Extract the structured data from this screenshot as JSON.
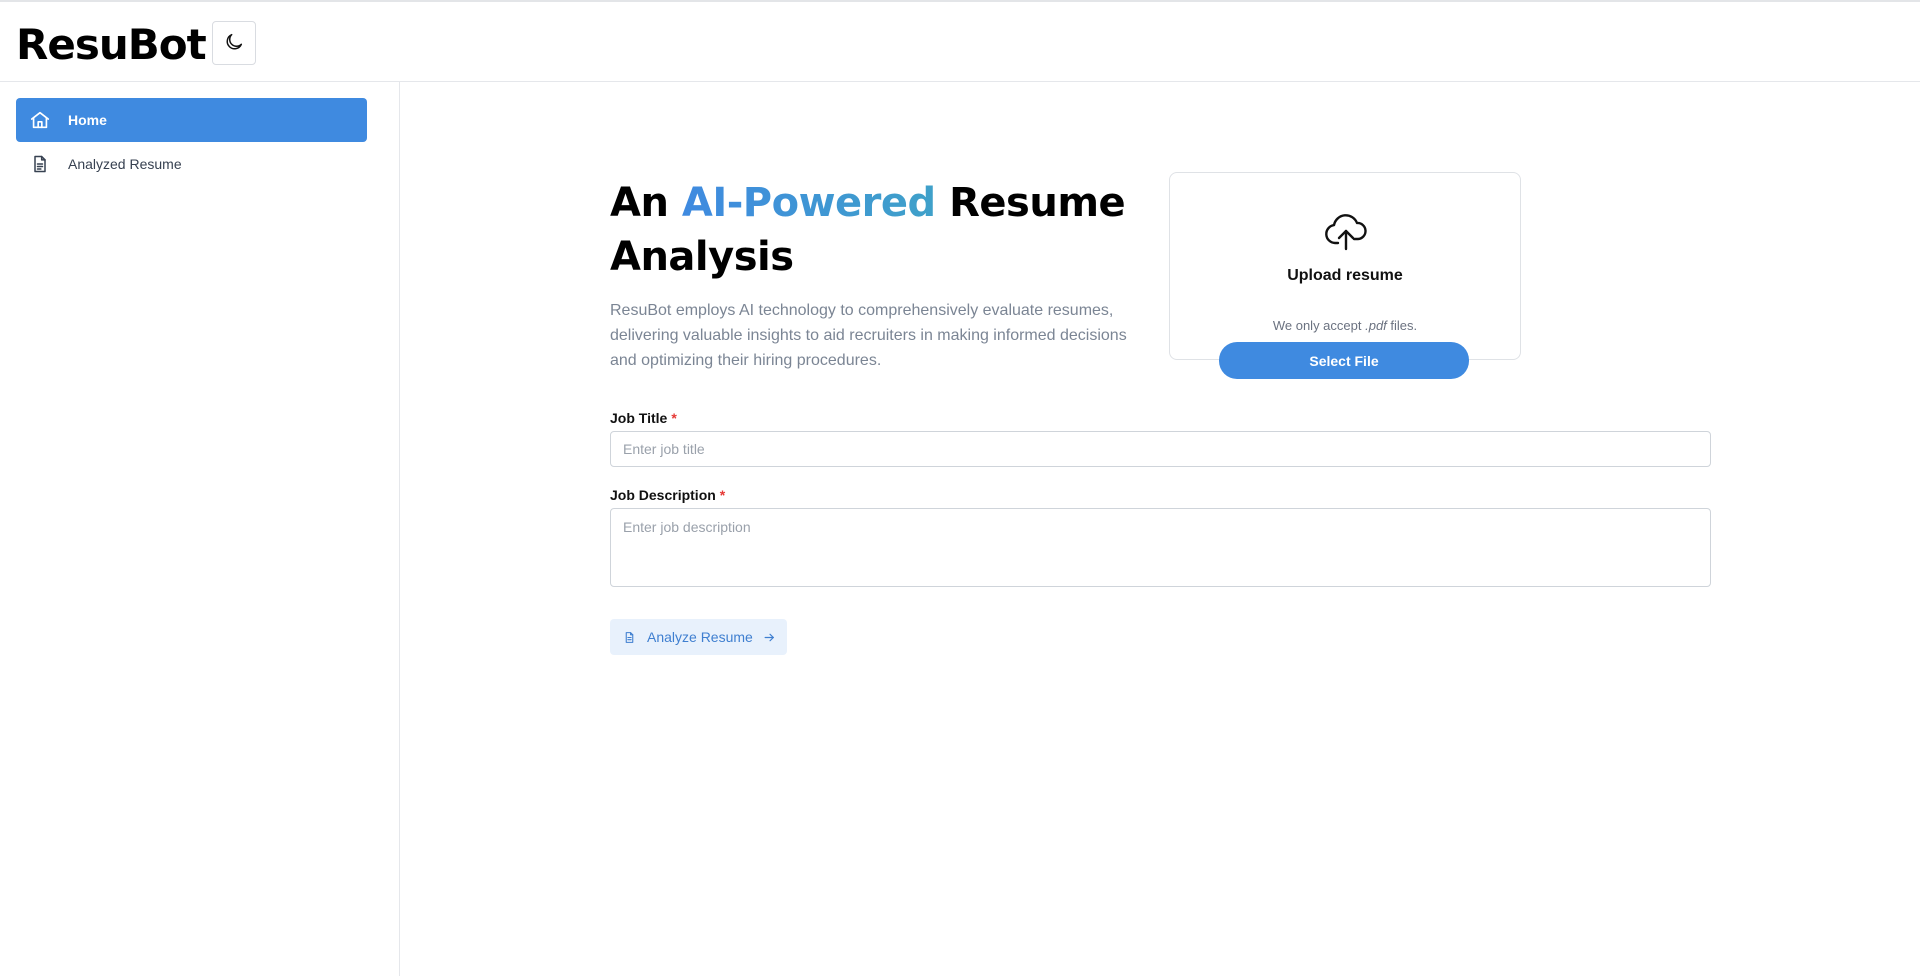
{
  "app": {
    "logo": "ResuBot",
    "theme_toggle_icon": "moon-icon"
  },
  "sidebar": {
    "items": [
      {
        "label": "Home",
        "icon": "home-icon",
        "active": true
      },
      {
        "label": "Analyzed Resume",
        "icon": "document-icon",
        "active": false
      }
    ]
  },
  "hero": {
    "title_prefix": "An ",
    "title_accent": "AI-Powered",
    "title_suffix": " Resume Analysis",
    "description": "ResuBot employs AI technology to comprehensively evaluate resumes, delivering valuable insights to aid recruiters in making informed decisions and optimizing their hiring procedures."
  },
  "upload": {
    "icon": "cloud-upload-icon",
    "title": "Upload resume",
    "note_prefix": "We only accept ",
    "note_ext": ".pdf",
    "note_suffix": " files.",
    "button_label": "Select File"
  },
  "form": {
    "job_title": {
      "label": "Job Title",
      "required_mark": "*",
      "placeholder": "Enter job title",
      "value": ""
    },
    "job_description": {
      "label": "Job Description",
      "required_mark": "*",
      "placeholder": "Enter job description",
      "value": ""
    },
    "analyze_button": {
      "label": "Analyze Resume",
      "icon": "document-icon",
      "trailing_icon": "arrow-right-icon"
    }
  },
  "colors": {
    "primary": "#3f8ae0",
    "accent_gradient_end": "#3fa1c9",
    "required": "#e53935",
    "button_soft_bg": "#e8f1fc"
  }
}
